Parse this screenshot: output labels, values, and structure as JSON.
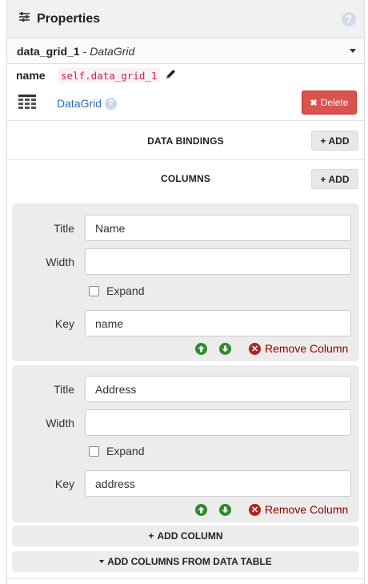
{
  "header": {
    "title": "Properties",
    "help_icon": "?"
  },
  "selector": {
    "name": "data_grid_1",
    "separator": "-",
    "type": "DataGrid"
  },
  "name_row": {
    "label": "name",
    "value": "self.data_grid_1"
  },
  "component": {
    "link": "DataGrid",
    "help_icon": "?",
    "delete_label": "Delete"
  },
  "data_bindings": {
    "title": "DATA BINDINGS",
    "add_label": "ADD"
  },
  "columns": {
    "title": "COLUMNS",
    "add_label": "ADD",
    "labels": {
      "title": "Title",
      "width": "Width",
      "expand": "Expand",
      "key": "Key",
      "remove": "Remove Column"
    },
    "items": [
      {
        "title": "Name",
        "width": "",
        "expand": false,
        "key": "name"
      },
      {
        "title": "Address",
        "width": "",
        "expand": false,
        "key": "address"
      }
    ]
  },
  "footer": {
    "add_column": "ADD COLUMN",
    "add_from_table": "ADD COLUMNS FROM DATA TABLE"
  },
  "colors": {
    "delete": "#d9534f",
    "code": "#c7254e",
    "link": "#2a6ebb",
    "arrows": "#2e8b2e",
    "remove": "#8b0000"
  }
}
